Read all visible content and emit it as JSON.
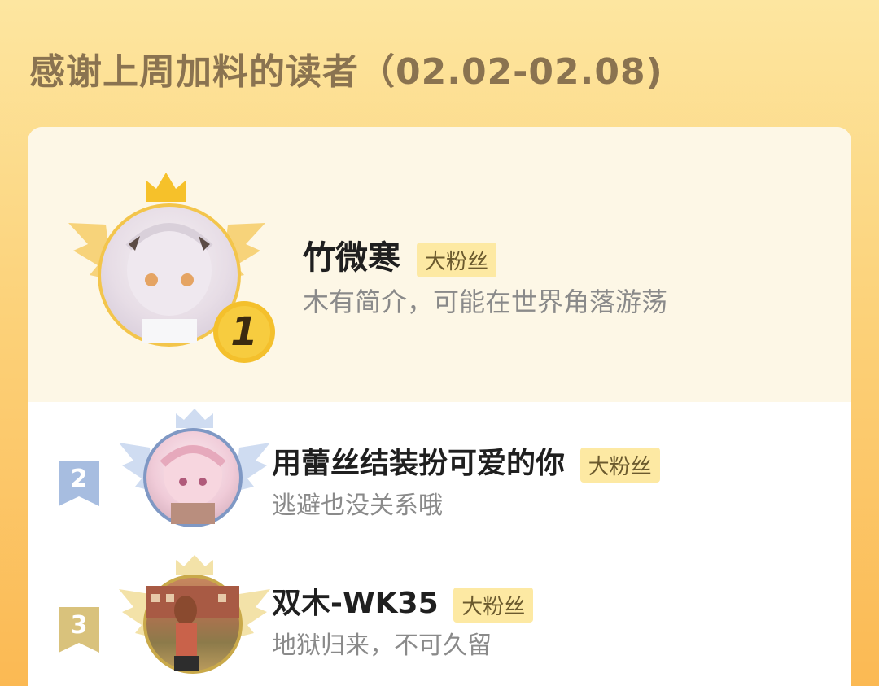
{
  "header": {
    "title": "感谢上周加料的读者（02.02-02.08)"
  },
  "readers": [
    {
      "rank": "1",
      "name": "竹微寒",
      "badge": "大粉丝",
      "bio": "木有简介，可能在世界角落游荡"
    },
    {
      "rank": "2",
      "name": "用蕾丝结装扮可爱的你",
      "badge": "大粉丝",
      "bio": "逃避也没关系哦"
    },
    {
      "rank": "3",
      "name": "双木-WK35",
      "badge": "大粉丝",
      "bio": "地狱归来，不可久留"
    }
  ],
  "colors": {
    "gold": "#f6c12a",
    "silver": "#a7bde0",
    "bronze": "#d9c27c",
    "badge_bg": "#fde9a3"
  },
  "icons": [
    "crown-icon",
    "wings-icon",
    "rank-medal-icon",
    "rank-flag-icon"
  ]
}
